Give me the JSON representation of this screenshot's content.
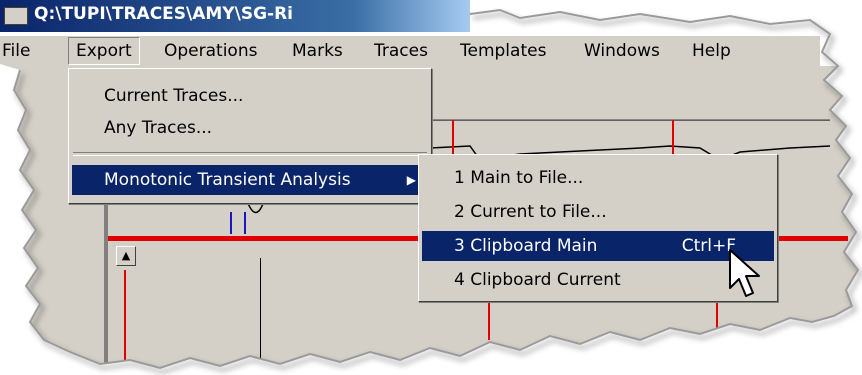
{
  "window": {
    "title": "Q:\\TUPI\\TRACES\\AMY\\SG-Ri"
  },
  "menubar": {
    "items": [
      {
        "id": "file",
        "label": "File"
      },
      {
        "id": "export",
        "label": "Export"
      },
      {
        "id": "operations",
        "label": "Operations"
      },
      {
        "id": "marks",
        "label": "Marks"
      },
      {
        "id": "traces",
        "label": "Traces"
      },
      {
        "id": "templates",
        "label": "Templates"
      },
      {
        "id": "windows",
        "label": "Windows"
      },
      {
        "id": "help",
        "label": "Help"
      }
    ]
  },
  "export_menu": {
    "items": [
      {
        "label": "Current Traces..."
      },
      {
        "label": "Any Traces..."
      },
      {
        "label": "Monotonic Transient Analysis",
        "submenu_arrow": "▶"
      }
    ]
  },
  "mta_submenu": {
    "items": [
      {
        "label": "1 Main to File..."
      },
      {
        "label": "2 Current to File..."
      },
      {
        "label": "3 Clipboard Main",
        "shortcut": "Ctrl+F"
      },
      {
        "label": "4 Clipboard Current"
      }
    ]
  },
  "colors": {
    "highlight": "#0a246a",
    "menu_bg": "#d4d0c8",
    "trace_red": "#e00000"
  },
  "icons": {
    "cursor": "arrow-pointer-icon",
    "scroll_up": "scroll-up-arrow-icon",
    "submenu": "chevron-right-icon"
  }
}
